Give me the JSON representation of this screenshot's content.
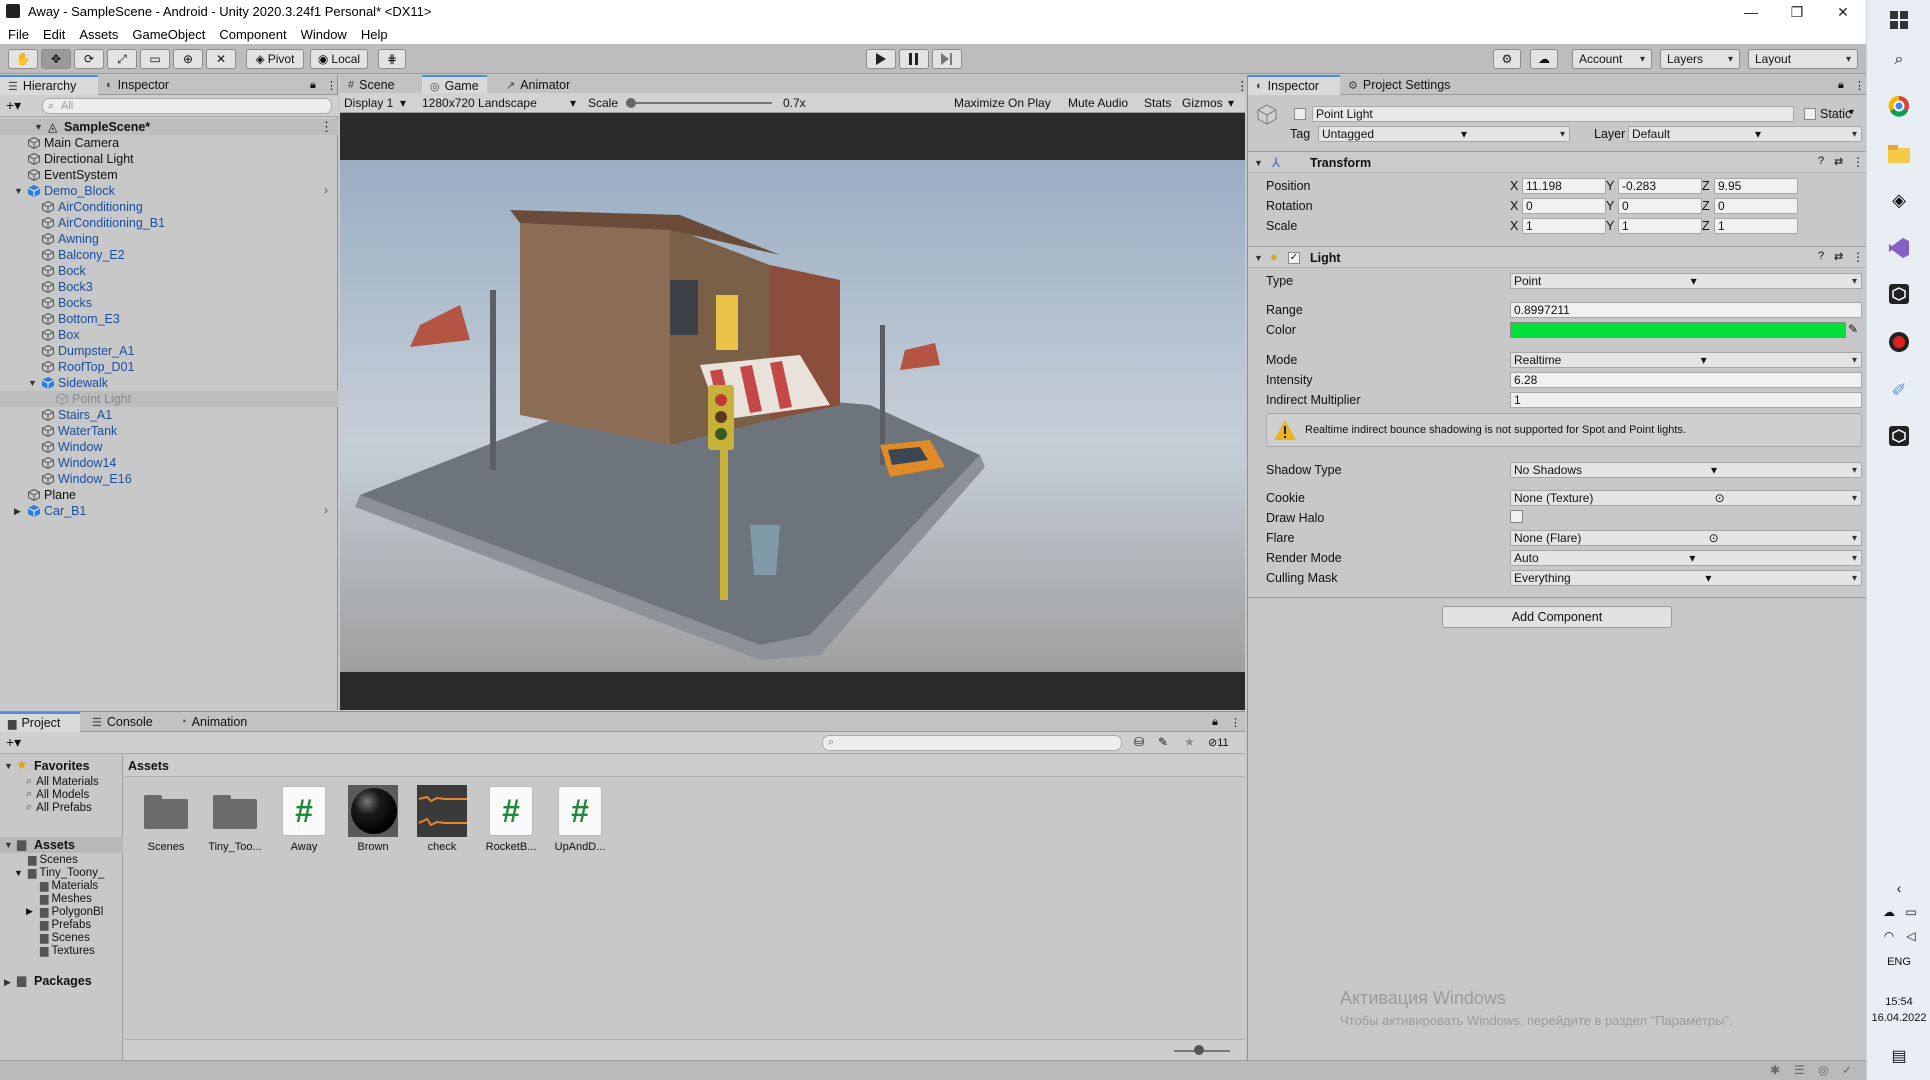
{
  "window": {
    "title": "Away - SampleScene - Android - Unity 2020.3.24f1 Personal* <DX11>",
    "controls": [
      "—",
      "❐",
      "✕"
    ]
  },
  "menu": [
    "File",
    "Edit",
    "Assets",
    "GameObject",
    "Component",
    "Window",
    "Help"
  ],
  "toolbar": {
    "pivot": "Pivot",
    "local": "Local",
    "account": "Account",
    "layers": "Layers",
    "layout": "Layout"
  },
  "hierarchy": {
    "tabs": [
      "Hierarchy",
      "Inspector"
    ],
    "search_placeholder": "All",
    "scene": "SampleScene*",
    "items": [
      {
        "label": "Main Camera",
        "depth": 1,
        "style": "normal"
      },
      {
        "label": "Directional Light",
        "depth": 1,
        "style": "normal"
      },
      {
        "label": "EventSystem",
        "depth": 1,
        "style": "normal"
      },
      {
        "label": "Demo_Block",
        "depth": 1,
        "style": "blue"
      },
      {
        "label": "AirConditioning",
        "depth": 2,
        "style": "blue"
      },
      {
        "label": "AirConditioning_B1",
        "depth": 2,
        "style": "blue"
      },
      {
        "label": "Awning",
        "depth": 2,
        "style": "blue"
      },
      {
        "label": "Balcony_E2",
        "depth": 2,
        "style": "blue"
      },
      {
        "label": "Bock",
        "depth": 2,
        "style": "blue"
      },
      {
        "label": "Bock3",
        "depth": 2,
        "style": "blue"
      },
      {
        "label": "Bocks",
        "depth": 2,
        "style": "blue"
      },
      {
        "label": "Bottom_E3",
        "depth": 2,
        "style": "blue"
      },
      {
        "label": "Box",
        "depth": 2,
        "style": "blue"
      },
      {
        "label": "Dumpster_A1",
        "depth": 2,
        "style": "blue"
      },
      {
        "label": "RoofTop_D01",
        "depth": 2,
        "style": "blue"
      },
      {
        "label": "Sidewalk",
        "depth": 2,
        "style": "blue"
      },
      {
        "label": "Point Light",
        "depth": 3,
        "style": "grey"
      },
      {
        "label": "Stairs_A1",
        "depth": 2,
        "style": "blue"
      },
      {
        "label": "WaterTank",
        "depth": 2,
        "style": "blue"
      },
      {
        "label": "Window",
        "depth": 2,
        "style": "blue"
      },
      {
        "label": "Window14",
        "depth": 2,
        "style": "blue"
      },
      {
        "label": "Window_E16",
        "depth": 2,
        "style": "blue"
      },
      {
        "label": "Plane",
        "depth": 1,
        "style": "normal"
      },
      {
        "label": "Car_B1",
        "depth": 1,
        "style": "blue"
      }
    ]
  },
  "game": {
    "tabs": [
      "Scene",
      "Game",
      "Animator"
    ],
    "display": "Display 1",
    "resolution": "1280x720 Landscape",
    "scale_label": "Scale",
    "scale_value": "0.7x",
    "buttons": [
      "Maximize On Play",
      "Mute Audio",
      "Stats",
      "Gizmos"
    ]
  },
  "inspector": {
    "tabs": [
      "Inspector",
      "Project Settings"
    ],
    "object_name": "Point Light",
    "static_label": "Static",
    "tag_label": "Tag",
    "tag_value": "Untagged",
    "layer_label": "Layer",
    "layer_value": "Default",
    "transform": {
      "title": "Transform",
      "rows": [
        {
          "label": "Position",
          "x": "11.198",
          "y": "-0.283",
          "z": "9.95"
        },
        {
          "label": "Rotation",
          "x": "0",
          "y": "0",
          "z": "0"
        },
        {
          "label": "Scale",
          "x": "1",
          "y": "1",
          "z": "1"
        }
      ]
    },
    "light": {
      "title": "Light",
      "type_label": "Type",
      "type_value": "Point",
      "range_label": "Range",
      "range_value": "0.8997211",
      "color_label": "Color",
      "color_value": "#00e03a",
      "mode_label": "Mode",
      "mode_value": "Realtime",
      "intensity_label": "Intensity",
      "intensity_value": "6.28",
      "indirect_label": "Indirect Multiplier",
      "indirect_value": "1",
      "warning": "Realtime indirect bounce shadowing is not supported for Spot and Point lights.",
      "shadow_label": "Shadow Type",
      "shadow_value": "No Shadows",
      "cookie_label": "Cookie",
      "cookie_value": "None (Texture)",
      "halo_label": "Draw Halo",
      "flare_label": "Flare",
      "flare_value": "None (Flare)",
      "render_label": "Render Mode",
      "render_value": "Auto",
      "culling_label": "Culling Mask",
      "culling_value": "Everything"
    },
    "add_component": "Add Component"
  },
  "project": {
    "tabs": [
      "Project",
      "Console",
      "Animation"
    ],
    "hidden_count": "11",
    "favorites": "Favorites",
    "favorite_items": [
      "All Materials",
      "All Models",
      "All Prefabs"
    ],
    "assets_root": "Assets",
    "tree": [
      {
        "label": "Scenes",
        "depth": 1
      },
      {
        "label": "Tiny_Toony_",
        "depth": 1
      },
      {
        "label": "Materials",
        "depth": 2
      },
      {
        "label": "Meshes",
        "depth": 2
      },
      {
        "label": "PolygonBl",
        "depth": 2
      },
      {
        "label": "Prefabs",
        "depth": 2
      },
      {
        "label": "Scenes",
        "depth": 2
      },
      {
        "label": "Textures",
        "depth": 2
      }
    ],
    "packages": "Packages",
    "breadcrumb": "Assets",
    "assets": [
      {
        "label": "Scenes",
        "kind": "folder"
      },
      {
        "label": "Tiny_Too...",
        "kind": "folder"
      },
      {
        "label": "Away",
        "kind": "script"
      },
      {
        "label": "Brown",
        "kind": "material"
      },
      {
        "label": "check",
        "kind": "audio"
      },
      {
        "label": "RocketB...",
        "kind": "script"
      },
      {
        "label": "UpAndD...",
        "kind": "script"
      }
    ]
  },
  "os": {
    "activation_title": "Активация Windows",
    "activation_text": "Чтобы активировать Windows, перейдите в раздел \"Параметры\".",
    "lang": "ENG",
    "time": "15:54",
    "date": "16.04.2022"
  }
}
